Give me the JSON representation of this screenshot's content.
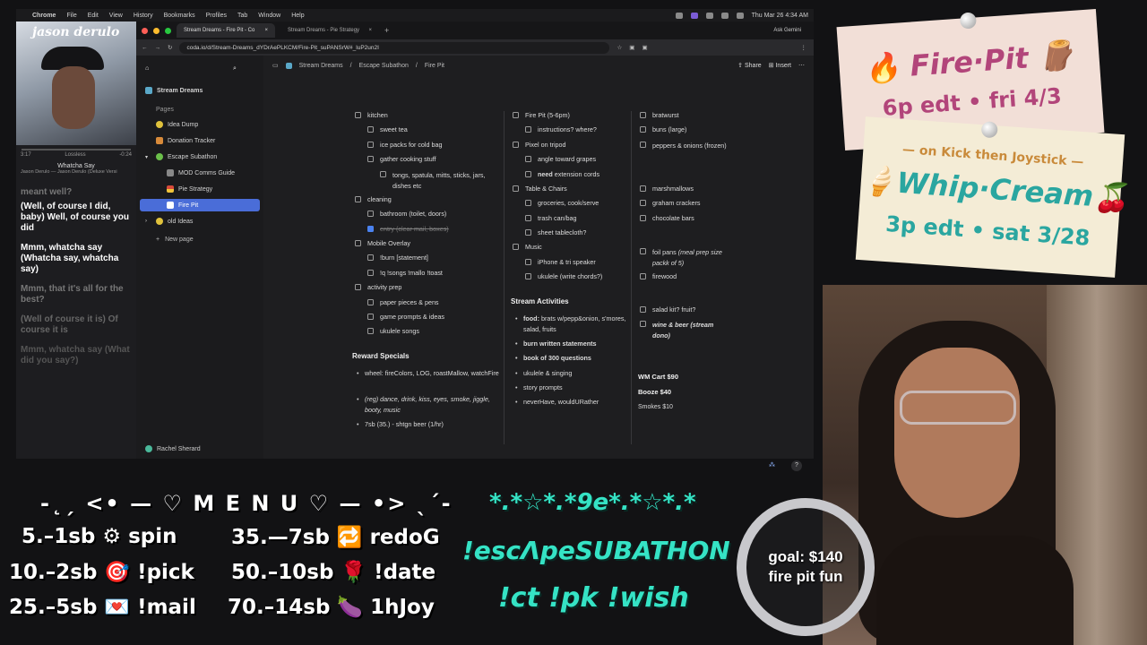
{
  "menubar": {
    "app": "Chrome",
    "items": [
      "File",
      "Edit",
      "View",
      "History",
      "Bookmarks",
      "Profiles",
      "Tab",
      "Window",
      "Help"
    ],
    "clock": "Thu Mar 26  4:34 AM"
  },
  "music": {
    "album_title": "jason derulo",
    "elapsed": "3:17",
    "quality": "Lossless",
    "remaining": "-0:24",
    "song": "Whatcha Say",
    "artist_line": "Jason Derulo — Jason Derulo (Deluxe Versi",
    "lyrics": [
      "meant well?",
      "(Well, of course I did, baby) Well, of course you did",
      "Mmm, whatcha say (Whatcha say, whatcha say)",
      "Mmm, that it's all for the best?",
      "(Well of course it is) Of course it is",
      "Mmm, whatcha say (What did you say?)"
    ]
  },
  "browser": {
    "tabs": [
      "Stream Dreams - Fire Pit - Co",
      "Stream Dreams - Pie Strategy"
    ],
    "url": "coda.io/d/Stream-Dreams_dYDrAePLKCM/Fire-Pit_suPANSrW#_luP2un2I",
    "ask": "Ask Gemini"
  },
  "sidebar": {
    "doc_name": "Stream Dreams",
    "pages_label": "Pages",
    "items": [
      {
        "label": "Idea Dump",
        "color": "#e0c23c"
      },
      {
        "label": "Donation Tracker",
        "color": "#d88a3a"
      },
      {
        "label": "Escape Subathon",
        "color": "#6bbf4a"
      },
      {
        "label": "MOD Comms Guide",
        "color": "#888888"
      },
      {
        "label": "Pie Strategy",
        "color": "#d84a3a"
      },
      {
        "label": "Fire Pit",
        "color": "#4a6dd8"
      },
      {
        "label": "old Ideas",
        "color": "#e0c23c"
      }
    ],
    "new_page": "New page",
    "user": "Rachel Sherard"
  },
  "doc": {
    "breadcrumb": [
      "Stream Dreams",
      "Escape Subathon",
      "Fire Pit"
    ],
    "share": "Share",
    "insert": "Insert",
    "col1": {
      "kitchen": "kitchen",
      "sweet_tea": "sweet tea",
      "ice_packs": "ice packs for cold bag",
      "gather": "gather cooking stuff",
      "tongs": "tongs, spatula, mitts, sticks, jars, dishes etc",
      "cleaning": "cleaning",
      "bathroom": "bathroom (toilet, doors)",
      "entry": "entry (clear mail, boxes)",
      "mobile": "Mobile Overlay",
      "burn": "!burn [statement]",
      "songs": "!q !songs !mallo !toast",
      "activity": "activity prep",
      "paper": "paper pieces & pens",
      "game": "game prompts & ideas",
      "ukulele_songs": "ukulele songs",
      "reward_title": "Reward Specials",
      "reward1": "wheel: fireColors, LOG, roastMallow, watchFire",
      "reward2": "(reg) dance, drink, kiss, eyes, smoke, jiggle, booty, music",
      "reward3": "7sb (35.) - shtgn beer (1/hr)"
    },
    "col2": {
      "firepit": "Fire Pit (5-6pm)",
      "instructions": "instructions? where?",
      "pixel": "Pixel on tripod",
      "angle": "angle toward grapes",
      "need_bold": "need",
      "need_rest": " extension cords",
      "table": "Table & Chairs",
      "groceries": "groceries, cook/serve",
      "trash": "trash can/bag",
      "sheet": "sheet tablecloth?",
      "music": "Music",
      "iphone": "iPhone & tri speaker",
      "ukulele_chords": "ukulele (write chords?)",
      "activities_title": "Stream Activities",
      "act_food_bold": "food:",
      "act_food_rest": " brats w/pepp&onion, s'mores, salad, fruits",
      "act2": "burn written statements",
      "act3": "book of 300 questions",
      "act4": "ukulele & singing",
      "act5": "story prompts",
      "act6": "neverHave, wouldURather"
    },
    "col3": {
      "bratwurst": "bratwurst",
      "buns": "buns (large)",
      "peppers": "peppers & onions (frozen)",
      "marshmallows": "marshmallows",
      "graham": "graham crackers",
      "chocolate": "chocolate bars",
      "foil": "foil pans",
      "foil_note": "(meal prep size packk of 5)",
      "firewood": "firewood",
      "salad": "salad kit? fruit?",
      "wine": "wine & beer (stream dono)",
      "wm_cart": "WM Cart $90",
      "booze": "Booze $40",
      "smokes": "Smokes $10"
    }
  },
  "overlay": {
    "menu_title": "-˛ˏ <• — ♡ M E N U ♡ — •> ˎˊ-",
    "menu_items": [
      {
        "price": "5.–1sb",
        "icon": "⚙",
        "cmd": "spin"
      },
      {
        "price": "10.–2sb",
        "icon": "🎯",
        "cmd": "!pick"
      },
      {
        "price": "25.–5sb",
        "icon": "💌",
        "cmd": "!mail"
      },
      {
        "price": "35.—7sb",
        "icon": "🔁",
        "cmd": "redoG"
      },
      {
        "price": "50.–10sb",
        "icon": "🌹",
        "cmd": "!date"
      },
      {
        "price": "70.–14sb",
        "icon": "🍆",
        "cmd": "1hJoy"
      }
    ],
    "teal_deco": "*.*☆*.*9e*.*☆*.*",
    "teal_main": "!escΛpeSUBATHON",
    "teal_cmds": "!ct !pk !wish",
    "goal_line1": "goal: $140",
    "goal_line2": "fire pit fun"
  },
  "notes": {
    "note1_title": "Fire·Pit",
    "note1_sub": "6p edt • fri 4/3",
    "note2_top": "— on Kick then Joystick —",
    "note2_title": "Whip·Cream",
    "note2_sub": "3p edt • sat 3/28"
  },
  "colors": {
    "accent": "#4a6dd8",
    "teal": "#35e3c5",
    "note_pink": "#f2dfd7",
    "note_cream": "#f4ecd6",
    "note_text": "#b2457a"
  }
}
